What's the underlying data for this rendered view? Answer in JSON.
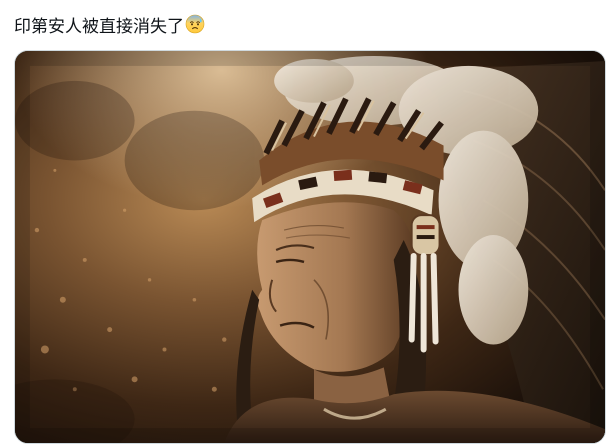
{
  "post": {
    "text": "印第安人被直接消失了",
    "emoji": "anxious-face-with-sweat-icon"
  },
  "media": {
    "type": "photo",
    "subject": "portrait-photo",
    "palette": {
      "background_dark": "#2a1a0e",
      "background_glow": "#b98a55",
      "skin": "#a47852",
      "feather_white": "#efe6d8",
      "headband": "#8b5a34"
    }
  }
}
